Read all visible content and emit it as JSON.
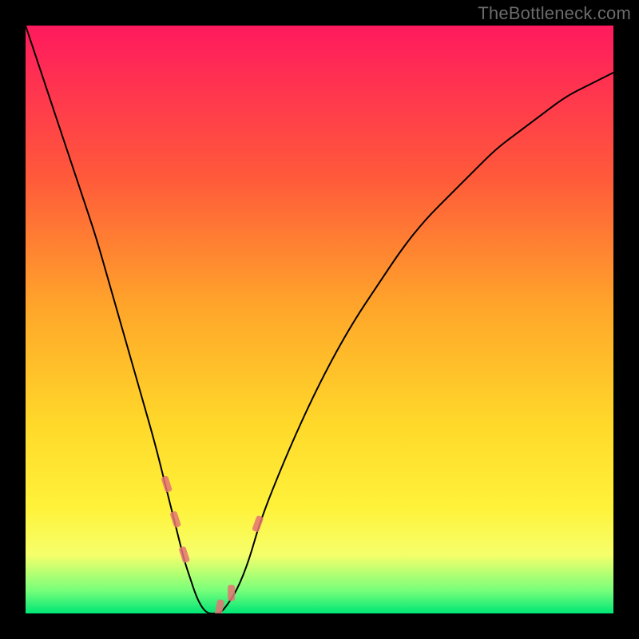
{
  "watermark": "TheBottleneck.com",
  "chart_data": {
    "type": "line",
    "title": "",
    "xlabel": "",
    "ylabel": "",
    "xlim": [
      0,
      100
    ],
    "ylim": [
      0,
      100
    ],
    "x": [
      0,
      2,
      4,
      6,
      8,
      10,
      12,
      14,
      16,
      18,
      20,
      22,
      24,
      26,
      27,
      28,
      29,
      30,
      31,
      32,
      33,
      34,
      36,
      38,
      40,
      44,
      48,
      52,
      56,
      60,
      64,
      68,
      72,
      76,
      80,
      84,
      88,
      92,
      96,
      100
    ],
    "values": [
      100,
      94,
      88,
      82,
      76,
      70,
      64,
      57,
      50,
      43,
      36,
      29,
      21,
      13,
      9,
      6,
      3,
      1,
      0,
      0,
      0,
      1,
      4,
      9,
      16,
      26,
      35,
      43,
      50,
      56,
      62,
      67,
      71,
      75,
      79,
      82,
      85,
      88,
      90,
      92
    ],
    "ticks_x": [
      24,
      25.5,
      27,
      33,
      35,
      39.5
    ],
    "gradient_stops": [
      {
        "offset": 0,
        "color": "#ff1a5e"
      },
      {
        "offset": 26,
        "color": "#ff5a3a"
      },
      {
        "offset": 48,
        "color": "#ffa62a"
      },
      {
        "offset": 68,
        "color": "#ffd92a"
      },
      {
        "offset": 82,
        "color": "#fff23a"
      },
      {
        "offset": 90,
        "color": "#f6ff6a"
      },
      {
        "offset": 96,
        "color": "#7aff7a"
      },
      {
        "offset": 100,
        "color": "#00e676"
      }
    ],
    "tick_band_y": 6
  }
}
